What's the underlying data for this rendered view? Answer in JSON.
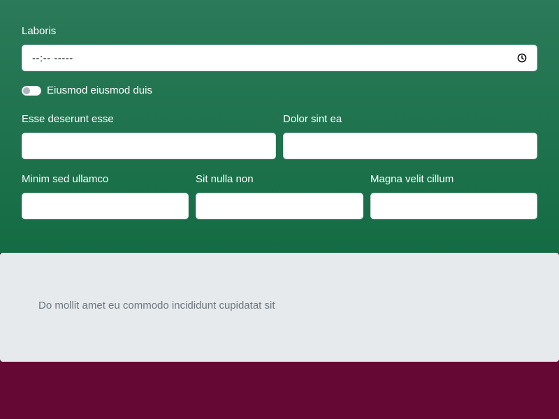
{
  "form": {
    "time_field": {
      "label": "Laboris",
      "placeholder": "--:-- -----"
    },
    "switch": {
      "label": "Eiusmod eiusmod duis",
      "checked": false
    },
    "row1": [
      {
        "label": "Esse deserunt esse",
        "value": ""
      },
      {
        "label": "Dolor sint ea",
        "value": ""
      }
    ],
    "row2": [
      {
        "label": "Minim sed ullamco",
        "value": ""
      },
      {
        "label": "Sit nulla non",
        "value": ""
      },
      {
        "label": "Magna velit cillum",
        "value": ""
      }
    ]
  },
  "card": {
    "text": "Do mollit amet eu commodo incididunt cupidatat sit"
  },
  "colors": {
    "form_gradient_top": "#2b7a5a",
    "form_gradient_bottom": "#146c43",
    "card_background": "#e7eaed",
    "page_background": "#650834"
  },
  "icons": {
    "time": "clock-icon"
  }
}
